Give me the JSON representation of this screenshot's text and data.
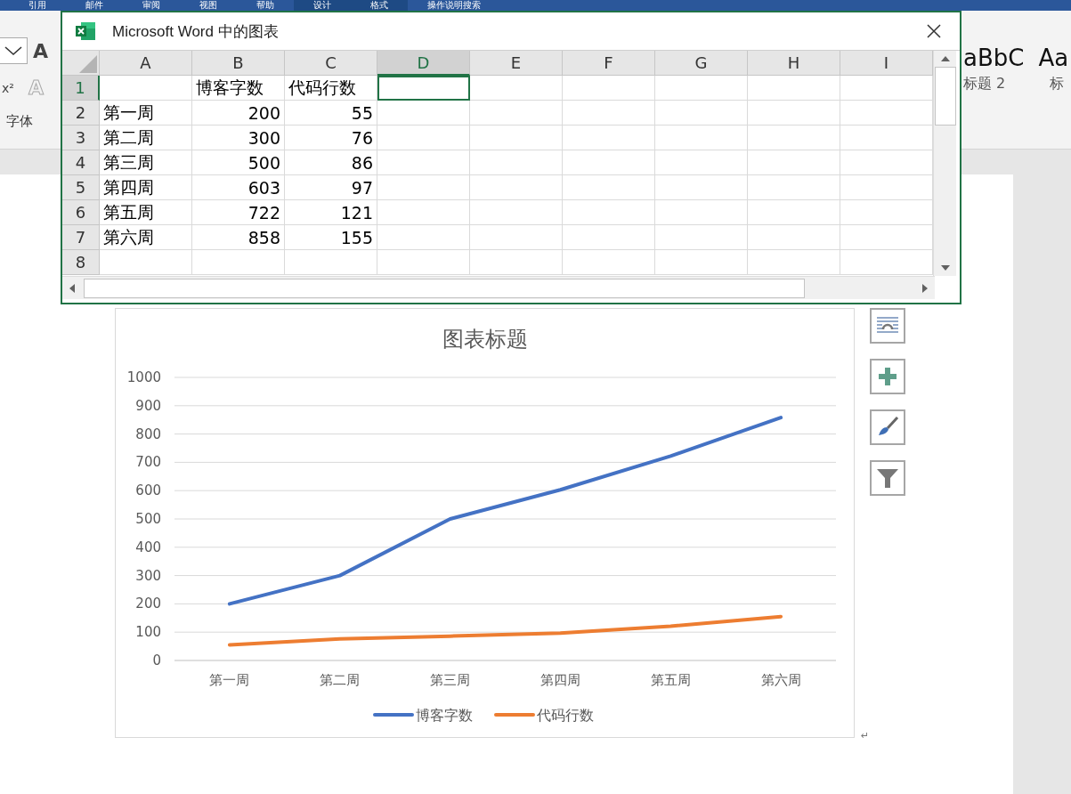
{
  "ribbon_tabs": [
    {
      "label": "引用",
      "selected": false
    },
    {
      "label": "邮件",
      "selected": false
    },
    {
      "label": "审阅",
      "selected": false
    },
    {
      "label": "视图",
      "selected": false
    },
    {
      "label": "帮助",
      "selected": false
    },
    {
      "label": "设计",
      "selected": true
    },
    {
      "label": "格式",
      "selected": true
    },
    {
      "label": "操作说明搜索",
      "selected": false
    }
  ],
  "ribbon": {
    "grow_font": "A",
    "superscript": "x²",
    "text_effect": "A",
    "group_label": "字体",
    "style_previews": [
      "aBbC",
      "Aa"
    ],
    "style_names": [
      "标题 2",
      "标"
    ]
  },
  "excel_window": {
    "title": "Microsoft Word 中的图表",
    "columns": [
      {
        "label": "A",
        "selected": false
      },
      {
        "label": "B",
        "selected": false
      },
      {
        "label": "C",
        "selected": false
      },
      {
        "label": "D",
        "selected": true
      },
      {
        "label": "E",
        "selected": false
      },
      {
        "label": "F",
        "selected": false
      },
      {
        "label": "G",
        "selected": false
      },
      {
        "label": "H",
        "selected": false
      },
      {
        "label": "I",
        "selected": false
      }
    ],
    "rows": [
      {
        "number": "1",
        "selected": true,
        "kind": "header",
        "b": "博客字数",
        "c": "代码行数"
      },
      {
        "number": "2",
        "selected": false,
        "kind": "data",
        "a": "第一周",
        "b": "200",
        "c": "55"
      },
      {
        "number": "3",
        "selected": false,
        "kind": "data",
        "a": "第二周",
        "b": "300",
        "c": "76"
      },
      {
        "number": "4",
        "selected": false,
        "kind": "data",
        "a": "第三周",
        "b": "500",
        "c": "86"
      },
      {
        "number": "5",
        "selected": false,
        "kind": "data",
        "a": "第四周",
        "b": "603",
        "c": "97"
      },
      {
        "number": "6",
        "selected": false,
        "kind": "data",
        "a": "第五周",
        "b": "722",
        "c": "121"
      },
      {
        "number": "7",
        "selected": false,
        "kind": "data",
        "a": "第六周",
        "b": "858",
        "c": "155"
      },
      {
        "number": "8",
        "selected": false
      }
    ]
  },
  "chart": {
    "chart_data": {
      "type": "line",
      "title": "图表标题",
      "categories": [
        "第一周",
        "第二周",
        "第三周",
        "第四周",
        "第五周",
        "第六周"
      ],
      "series": [
        {
          "name": "博客字数",
          "color": "#4472c4",
          "values": [
            200,
            300,
            500,
            603,
            722,
            858
          ]
        },
        {
          "name": "代码行数",
          "color": "#ed7d31",
          "values": [
            55,
            76,
            86,
            97,
            121,
            155
          ]
        }
      ],
      "grid": true,
      "legend": "bottom",
      "ylim": [
        0,
        1000
      ],
      "yticks": [
        0,
        100,
        200,
        300,
        400,
        500,
        600,
        700,
        800,
        900,
        1000
      ]
    }
  },
  "paragraph_mark": "↵"
}
